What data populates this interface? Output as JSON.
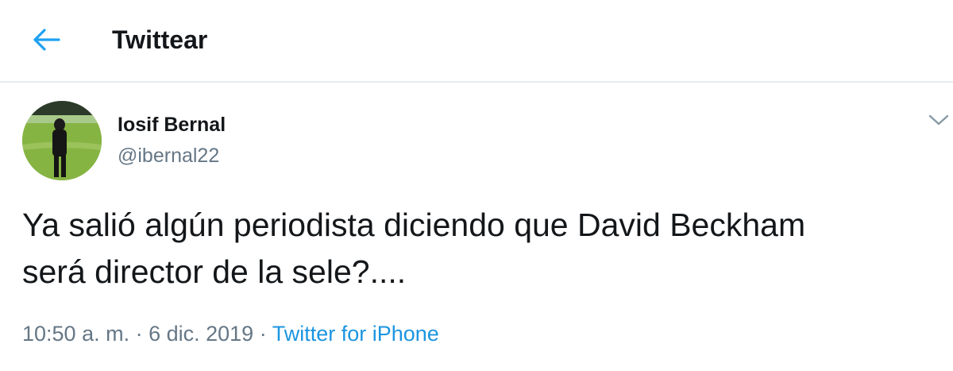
{
  "header": {
    "title": "Twittear",
    "back_icon": "arrow-left-icon",
    "accent": "#1da1f2"
  },
  "tweet": {
    "author_name": "Iosif Bernal",
    "author_handle": "@ibernal22",
    "text_line1": "Ya salió algún periodista diciendo que David Beckham",
    "text_line2": "será director de la sele?....",
    "time": "10:50 a. m.",
    "sep1": " · ",
    "date": "6 dic. 2019",
    "sep2": " · ",
    "source": "Twitter for iPhone",
    "caret_icon": "chevron-down-icon",
    "source_color": "#1b95e0"
  }
}
